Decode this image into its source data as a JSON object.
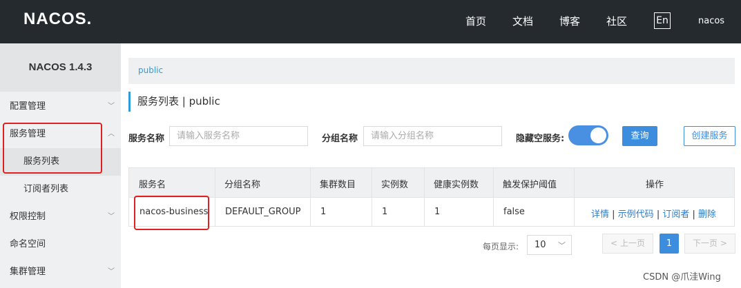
{
  "topbar": {
    "logo": "NACOS.",
    "nav": [
      "首页",
      "文档",
      "博客",
      "社区"
    ],
    "lang": "En",
    "user": "nacos"
  },
  "sidebar": {
    "title": "NACOS 1.4.3",
    "items": [
      {
        "label": "配置管理",
        "chevron": "chevron-down-icon"
      },
      {
        "label": "服务管理",
        "chevron": "chevron-up-icon"
      },
      {
        "label": "服务列表",
        "sub": true,
        "active": true
      },
      {
        "label": "订阅者列表",
        "sub": true
      },
      {
        "label": "权限控制",
        "chevron": "chevron-down-icon"
      },
      {
        "label": "命名空间"
      },
      {
        "label": "集群管理",
        "chevron": "chevron-down-icon"
      }
    ]
  },
  "breadcrumb": "public",
  "page_title": "服务列表 | public",
  "filters": {
    "service_name_label": "服务名称",
    "service_name_placeholder": "请输入服务名称",
    "group_name_label": "分组名称",
    "group_name_placeholder": "请输入分组名称",
    "hide_empty_label": "隐藏空服务:",
    "hide_empty_on": true,
    "query_button": "查询",
    "create_button": "创建服务"
  },
  "table": {
    "headers": [
      "服务名",
      "分组名称",
      "集群数目",
      "实例数",
      "健康实例数",
      "触发保护阈值",
      "操作"
    ],
    "rows": [
      {
        "service": "nacos-business",
        "group": "DEFAULT_GROUP",
        "clusters": "1",
        "instances": "1",
        "healthy": "1",
        "threshold": "false",
        "ops": [
          "详情",
          "示例代码",
          "订阅者",
          "删除"
        ]
      }
    ]
  },
  "pagination": {
    "page_size_label": "每页显示:",
    "page_size": "10",
    "prev": "上一页",
    "current": "1",
    "next": "下一页"
  },
  "watermark": "CSDN @爪洼Wing",
  "colors": {
    "topbar": "#252a2f",
    "accent": "#3c8dde",
    "link": "#2d9cdb",
    "highlight": "#e02020"
  }
}
